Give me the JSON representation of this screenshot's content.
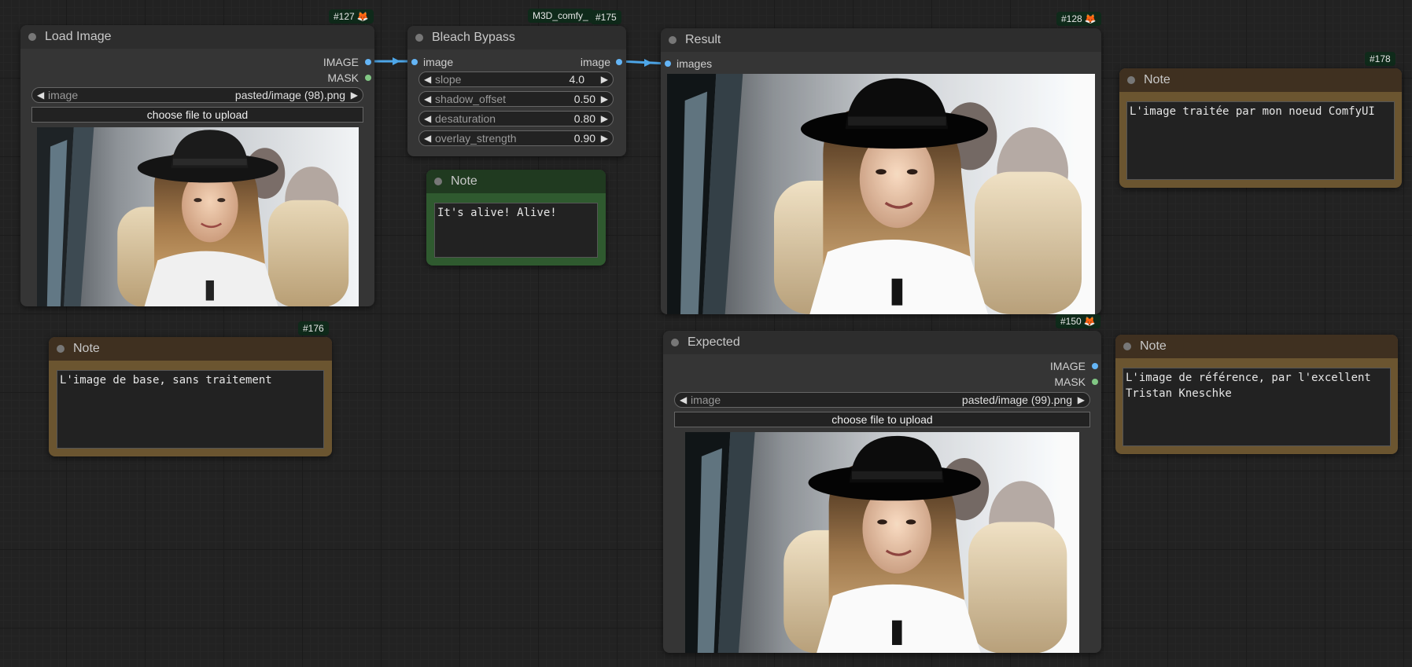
{
  "nodes": {
    "load_image": {
      "id": "#127",
      "title": "Load Image",
      "outputs": [
        "IMAGE",
        "MASK"
      ],
      "widget_label": "image",
      "widget_value": "pasted/image (98).png",
      "upload_label": "choose file to upload"
    },
    "bleach_bypass": {
      "id": "#175",
      "pack_label": "M3D_comfy_",
      "title": "Bleach Bypass",
      "input": "image",
      "output": "image",
      "params": [
        {
          "label": "slope",
          "value": "4.0"
        },
        {
          "label": "shadow_offset",
          "value": "0.50"
        },
        {
          "label": "desaturation",
          "value": "0.80"
        },
        {
          "label": "overlay_strength",
          "value": "0.90"
        }
      ]
    },
    "note_green": {
      "title": "Note",
      "text": "It's alive! Alive!"
    },
    "result": {
      "id": "#128",
      "title": "Result",
      "input": "images"
    },
    "note_178": {
      "id": "#178",
      "title": "Note",
      "text": "L'image traitée par mon noeud ComfyUI"
    },
    "note_176": {
      "id": "#176",
      "title": "Note",
      "text": "L'image de base, sans traitement"
    },
    "expected": {
      "id": "#150",
      "title": "Expected",
      "outputs": [
        "IMAGE",
        "MASK"
      ],
      "widget_label": "image",
      "widget_value": "pasted/image (99).png",
      "upload_label": "choose file to upload"
    },
    "note_ref": {
      "title": "Note",
      "text": "L'image de référence, par l'excellent\nTristan Kneschke"
    }
  },
  "icons": {
    "badge_icon": "fox-icon",
    "arrow_left": "◀",
    "arrow_right": "▶",
    "fox_glyph": "🦊"
  },
  "colors": {
    "canvas": "#222222",
    "node_body": "#353535",
    "node_title": "#2d2d2d",
    "note_brown_title": "#3f3020",
    "note_brown_border": "#6b5530",
    "note_green_title": "#203a20",
    "note_green_border": "#2f5a2f",
    "image_slot": "#64b5f6",
    "mask_slot": "#81c784",
    "link": "#4da6e8"
  }
}
